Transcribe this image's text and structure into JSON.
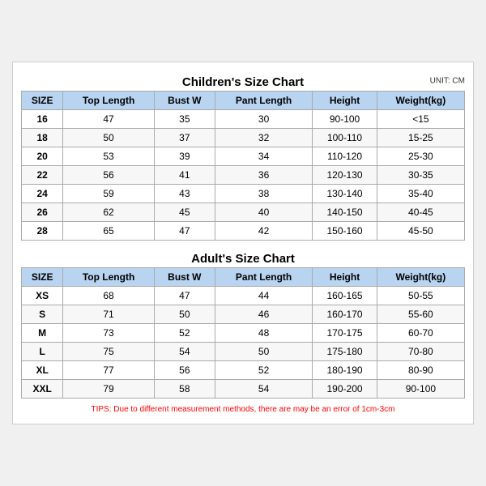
{
  "children_title": "Children's Size Chart",
  "adults_title": "Adult's Size Chart",
  "unit": "UNIT: CM",
  "headers": [
    "SIZE",
    "Top Length",
    "Bust W",
    "Pant Length",
    "Height",
    "Weight(kg)"
  ],
  "children_rows": [
    [
      "16",
      "47",
      "35",
      "30",
      "90-100",
      "<15"
    ],
    [
      "18",
      "50",
      "37",
      "32",
      "100-110",
      "15-25"
    ],
    [
      "20",
      "53",
      "39",
      "34",
      "110-120",
      "25-30"
    ],
    [
      "22",
      "56",
      "41",
      "36",
      "120-130",
      "30-35"
    ],
    [
      "24",
      "59",
      "43",
      "38",
      "130-140",
      "35-40"
    ],
    [
      "26",
      "62",
      "45",
      "40",
      "140-150",
      "40-45"
    ],
    [
      "28",
      "65",
      "47",
      "42",
      "150-160",
      "45-50"
    ]
  ],
  "adult_rows": [
    [
      "XS",
      "68",
      "47",
      "44",
      "160-165",
      "50-55"
    ],
    [
      "S",
      "71",
      "50",
      "46",
      "160-170",
      "55-60"
    ],
    [
      "M",
      "73",
      "52",
      "48",
      "170-175",
      "60-70"
    ],
    [
      "L",
      "75",
      "54",
      "50",
      "175-180",
      "70-80"
    ],
    [
      "XL",
      "77",
      "56",
      "52",
      "180-190",
      "80-90"
    ],
    [
      "XXL",
      "79",
      "58",
      "54",
      "190-200",
      "90-100"
    ]
  ],
  "tips": "TIPS: Due to different measurement methods, there are may be an error of 1cm-3cm"
}
